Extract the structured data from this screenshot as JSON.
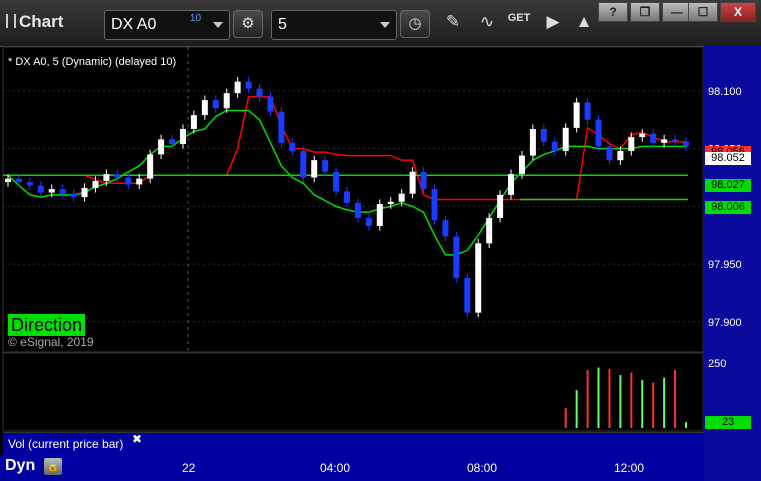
{
  "toolbar": {
    "app_title": "Chart",
    "symbol_value": "DX A0",
    "symbol_badge": "10",
    "interval_value": "5",
    "window_controls": [
      "?",
      "❒",
      "—",
      "☐",
      "X"
    ]
  },
  "chart_header": "* DX A0, 5 (Dynamic) (delayed 10)",
  "direction_label": "Direction",
  "copyright": "© eSignal, 2019",
  "vol_label": "Vol (current price bar)",
  "vol_close": "✖",
  "dyn_label": "Dyn",
  "colors": {
    "up_candle": "#ffffff",
    "down_candle": "#1a3cff",
    "slow_line": "#ff0000",
    "fast_line": "#00dd00",
    "scale_bg": "#0a0a9c"
  },
  "chart_data": {
    "type": "candlestick",
    "title": "DX A0, 5 (Dynamic) (delayed 10)",
    "x_ticks": [
      "22",
      "04:00",
      "08:00",
      "12:00"
    ],
    "y_ticks": [
      "98.100",
      "98.050",
      "98.000",
      "97.950",
      "97.900"
    ],
    "y_range": [
      97.88,
      98.125
    ],
    "price_tags": [
      {
        "label": "98.056",
        "color": "#ff3030"
      },
      {
        "label": "98.052",
        "color": "#ffffff"
      },
      {
        "label": "98.027",
        "color": "#00dd00"
      },
      {
        "label": "98.006",
        "color": "#00dd00"
      }
    ],
    "series": [
      {
        "name": "Price",
        "close": [
          98.024,
          98.021,
          98.018,
          98.012,
          98.015,
          98.011,
          98.008,
          98.016,
          98.022,
          98.028,
          98.025,
          98.019,
          98.024,
          98.045,
          98.058,
          98.054,
          98.067,
          98.079,
          98.092,
          98.085,
          98.098,
          98.108,
          98.102,
          98.095,
          98.082,
          98.055,
          98.048,
          98.025,
          98.04,
          98.03,
          98.013,
          98.003,
          97.99,
          97.983,
          98.002,
          98.004,
          98.011,
          98.03,
          98.015,
          97.988,
          97.974,
          97.938,
          97.908,
          97.968,
          97.99,
          98.01,
          98.028,
          98.044,
          98.067,
          98.056,
          98.048,
          98.068,
          98.09,
          98.075,
          98.052,
          98.04,
          98.048,
          98.06,
          98.063,
          98.055,
          98.058,
          98.056,
          98.052
        ]
      },
      {
        "name": "Slow line",
        "values": [
          98.027,
          98.027,
          98.027,
          98.027,
          98.027,
          98.027,
          98.027,
          98.027,
          98.023,
          98.02,
          98.02,
          98.02,
          98.02,
          98.027,
          98.027,
          98.027,
          98.027,
          98.027,
          98.027,
          98.027,
          98.027,
          98.05,
          98.095,
          98.095,
          98.095,
          98.07,
          98.05,
          98.05,
          98.047,
          98.047,
          98.045,
          98.044,
          98.044,
          98.044,
          98.044,
          98.044,
          98.04,
          98.04,
          98.01,
          98.006,
          98.006,
          98.006,
          98.006,
          98.006,
          98.006,
          98.006,
          98.006,
          98.006,
          98.006,
          98.006,
          98.006,
          98.006,
          98.006,
          98.068,
          98.062,
          98.054,
          98.05,
          98.062,
          98.064,
          98.06,
          98.056,
          98.056,
          98.056
        ]
      },
      {
        "name": "Fast line",
        "values": [
          98.027,
          98.018,
          98.01,
          98.008,
          98.01,
          98.01,
          98.01,
          98.012,
          98.017,
          98.02,
          98.024,
          98.03,
          98.035,
          98.045,
          98.052,
          98.052,
          98.059,
          98.065,
          98.067,
          98.078,
          98.083,
          98.083,
          98.083,
          98.075,
          98.055,
          98.035,
          98.025,
          98.02,
          98.01,
          98.005,
          98.0,
          97.997,
          97.995,
          97.995,
          97.998,
          98.0,
          98.003,
          98.0,
          97.995,
          97.975,
          97.958,
          97.958,
          97.962,
          97.975,
          97.99,
          98.005,
          98.02,
          98.03,
          98.04,
          98.045,
          98.048,
          98.052,
          98.052,
          98.052,
          98.05,
          98.05,
          98.05,
          98.05,
          98.052,
          98.052,
          98.052,
          98.052,
          98.052
        ]
      },
      {
        "name": "Green level",
        "values": [
          98.027
        ]
      },
      {
        "name": "Volume",
        "ticks": [
          "250",
          "23"
        ],
        "values": [
          0,
          0,
          0,
          0,
          0,
          0,
          0,
          0,
          0,
          0,
          0,
          0,
          0,
          0,
          0,
          0,
          0,
          0,
          0,
          0,
          0,
          0,
          0,
          0,
          0,
          0,
          0,
          0,
          0,
          0,
          0,
          0,
          0,
          0,
          0,
          0,
          0,
          0,
          0,
          0,
          0,
          0,
          0,
          0,
          0,
          0,
          0,
          0,
          0,
          0,
          0,
          80,
          150,
          230,
          240,
          235,
          210,
          220,
          190,
          180,
          200,
          230,
          23
        ]
      }
    ]
  }
}
